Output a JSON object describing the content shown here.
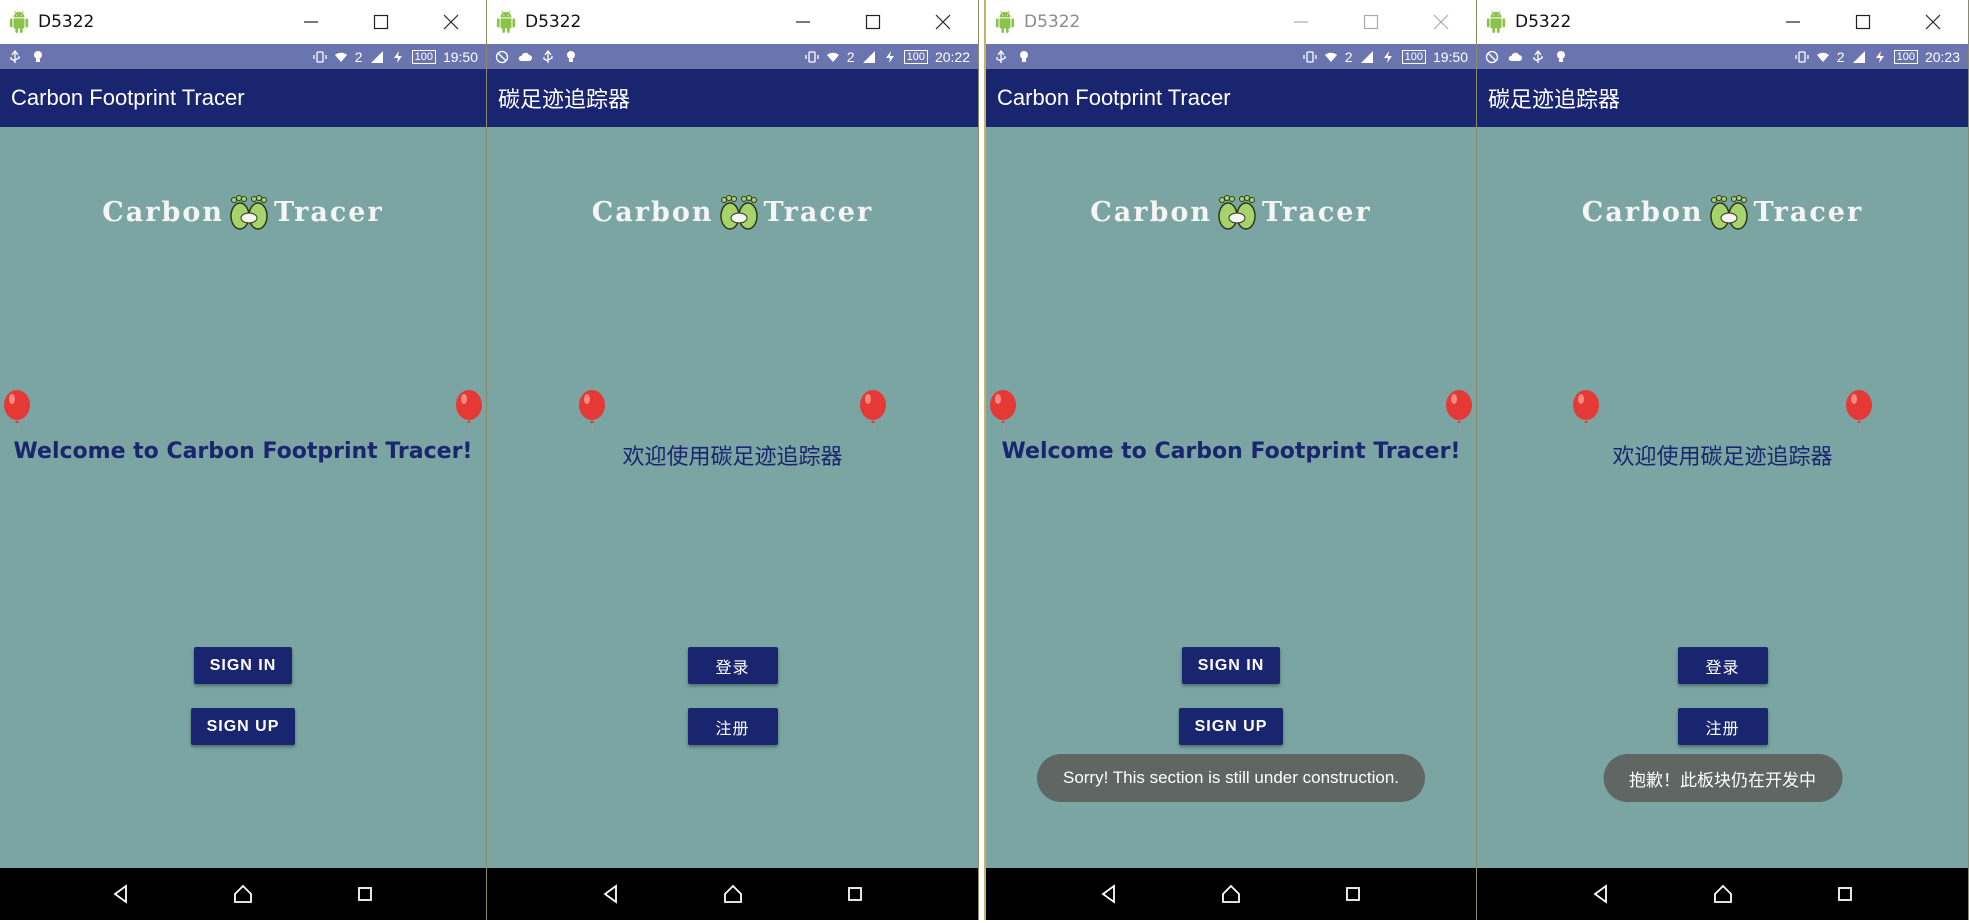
{
  "colors": {
    "status_bar": "#6a75b0",
    "app_bar": "#1a2570",
    "content_bg": "#7aa5a2",
    "button": "#1a2570",
    "toast": "#5f6664",
    "nav_bar": "#000000"
  },
  "windows": [
    {
      "title": "D5322",
      "status_time": "19:50",
      "battery": "100",
      "sim": "2",
      "app_title": "Carbon Footprint Tracer",
      "logo_left": "Carbon",
      "logo_right": "Tracer",
      "welcome": "Welcome to Carbon Footprint Tracer!",
      "sign_in": "SIGN IN",
      "sign_up": "SIGN UP",
      "toast": ""
    },
    {
      "title": "D5322",
      "status_time": "20:22",
      "battery": "100",
      "sim": "2",
      "app_title": "碳足迹追踪器",
      "logo_left": "Carbon",
      "logo_right": "Tracer",
      "welcome": "欢迎使用碳足迹追踪器",
      "sign_in": "登录",
      "sign_up": "注册",
      "toast": ""
    },
    {
      "title": "D5322",
      "status_time": "19:50",
      "battery": "100",
      "sim": "2",
      "app_title": "Carbon Footprint Tracer",
      "logo_left": "Carbon",
      "logo_right": "Tracer",
      "welcome": "Welcome to Carbon Footprint Tracer!",
      "sign_in": "SIGN IN",
      "sign_up": "SIGN UP",
      "toast": "Sorry! This section is still under construction."
    },
    {
      "title": "D5322",
      "status_time": "20:23",
      "battery": "100",
      "sim": "2",
      "app_title": "碳足迹追踪器",
      "logo_left": "Carbon",
      "logo_right": "Tracer",
      "welcome": "欢迎使用碳足迹追踪器",
      "sign_in": "登录",
      "sign_up": "注册",
      "toast": "抱歉！此板块仍在开发中"
    }
  ]
}
